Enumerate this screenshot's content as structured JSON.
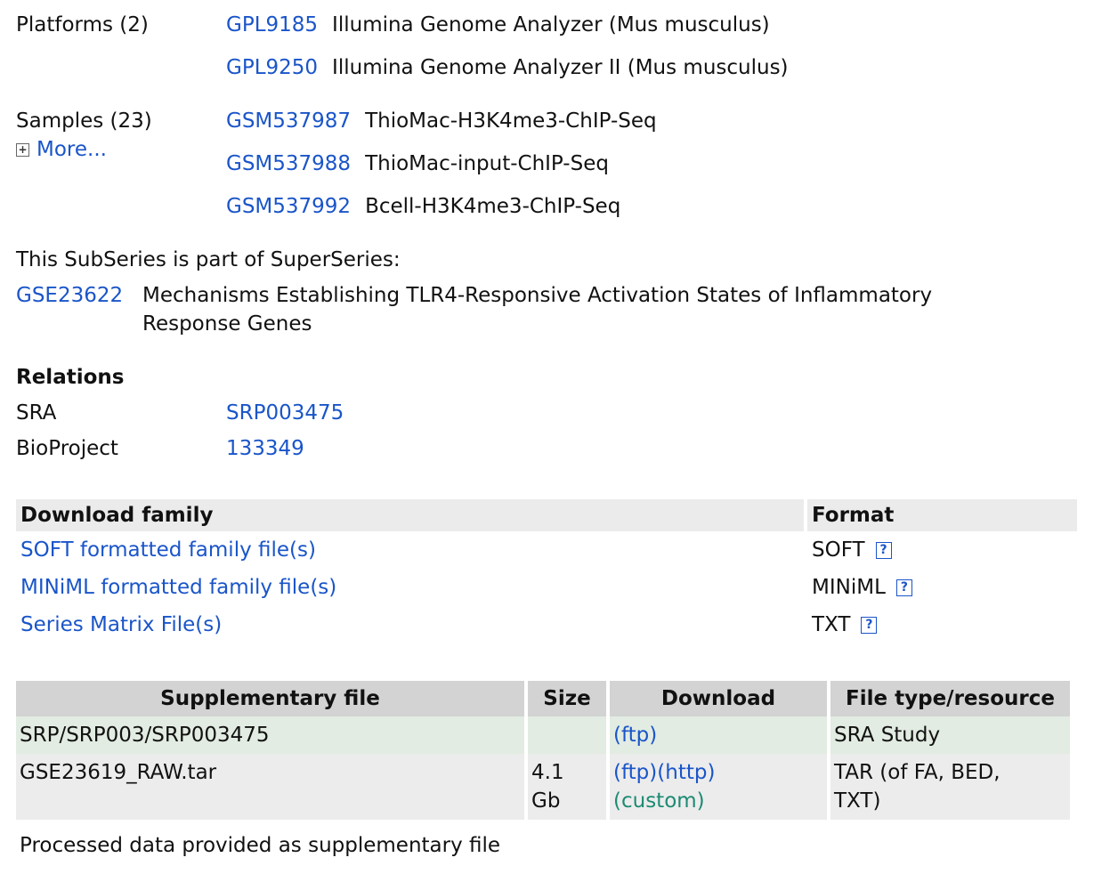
{
  "platforms": {
    "label": "Platforms (2)",
    "items": [
      {
        "id": "GPL9185",
        "title": "Illumina Genome Analyzer (Mus musculus)"
      },
      {
        "id": "GPL9250",
        "title": "Illumina Genome Analyzer II (Mus musculus)"
      }
    ]
  },
  "samples": {
    "label": "Samples (23)",
    "more": "More...",
    "items": [
      {
        "id": "GSM537987",
        "title": "ThioMac-H3K4me3-ChIP-Seq"
      },
      {
        "id": "GSM537988",
        "title": "ThioMac-input-ChIP-Seq"
      },
      {
        "id": "GSM537992",
        "title": "Bcell-H3K4me3-ChIP-Seq"
      }
    ]
  },
  "superseries": {
    "intro": "This SubSeries is part of SuperSeries:",
    "id": "GSE23622",
    "title_line1": "Mechanisms Establishing TLR4-Responsive Activation States of Inflammatory",
    "title_line2": "Response Genes"
  },
  "relations": {
    "heading": "Relations",
    "rows": [
      {
        "label": "SRA",
        "value": "SRP003475"
      },
      {
        "label": "BioProject",
        "value": "133349"
      }
    ]
  },
  "download_family": {
    "headers": {
      "name": "Download family",
      "format": "Format"
    },
    "rows": [
      {
        "name": "SOFT formatted family file(s)",
        "format": "SOFT",
        "help": "?"
      },
      {
        "name": "MINiML formatted family file(s)",
        "format": "MINiML",
        "help": "?"
      },
      {
        "name": "Series Matrix File(s)",
        "format": "TXT",
        "help": "?"
      }
    ]
  },
  "supplementary": {
    "headers": {
      "file": "Supplementary file",
      "size": "Size",
      "download": "Download",
      "type": "File type/resource"
    },
    "rows": [
      {
        "file": "SRP/SRP003/SRP003475",
        "size": "",
        "ftp": "(ftp)",
        "http": "",
        "custom": "",
        "type": "SRA Study"
      },
      {
        "file": "GSE23619_RAW.tar",
        "size_line1": "4.1",
        "size_line2": "Gb",
        "ftp": "(ftp)",
        "http": "(http)",
        "custom": "(custom)",
        "type_line1": "TAR (of FA, BED,",
        "type_line2": "TXT)"
      }
    ],
    "note": "Processed data provided as supplementary file"
  }
}
